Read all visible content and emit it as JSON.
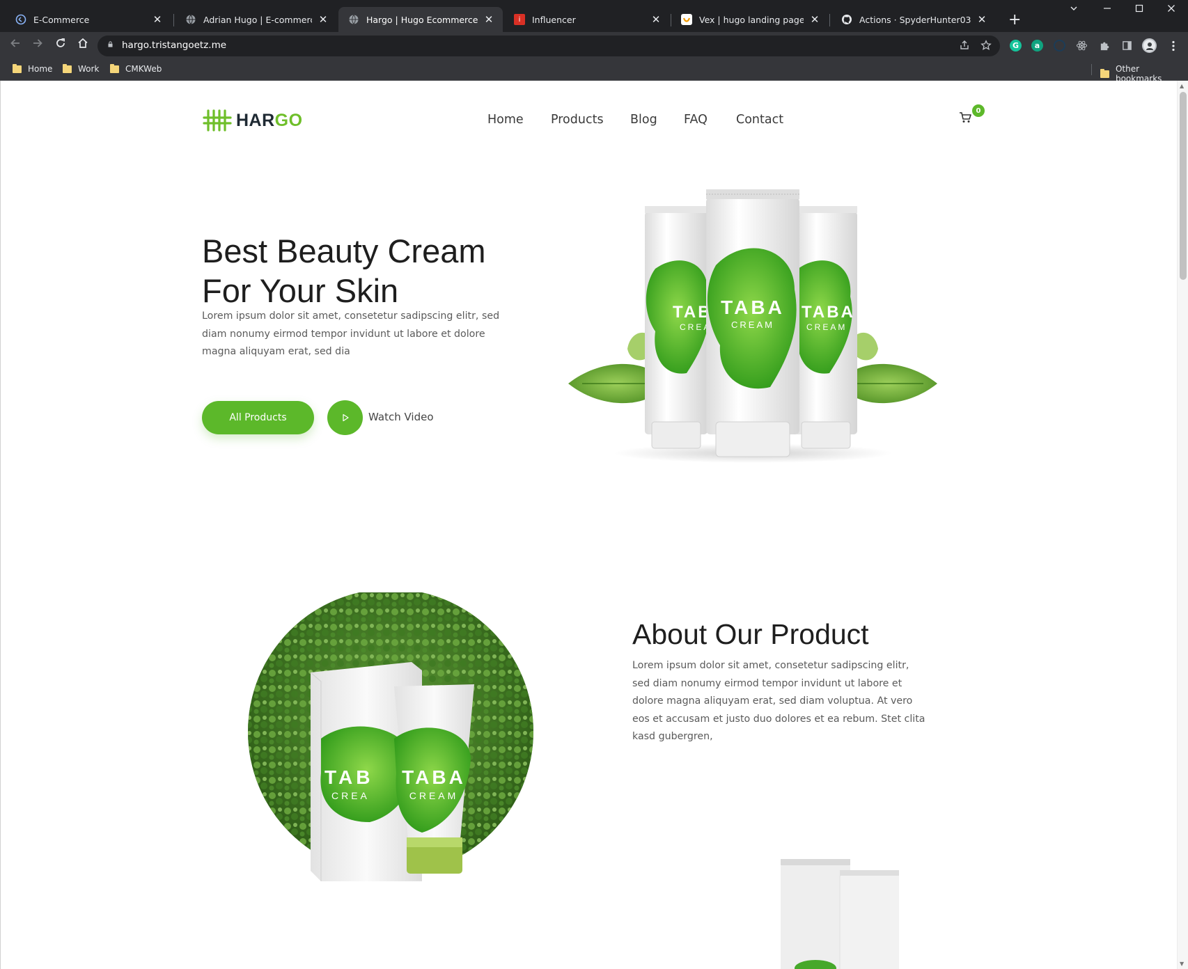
{
  "browser": {
    "tabs": [
      {
        "title": "E-Commerce",
        "icon": "ecommerce-favicon"
      },
      {
        "title": "Adrian Hugo | E-commerce temp",
        "icon": "globe-favicon"
      },
      {
        "title": "Hargo | Hugo Ecommerce Site",
        "icon": "globe-favicon",
        "active": true
      },
      {
        "title": "Influencer",
        "icon": "influencer-favicon"
      },
      {
        "title": "Vex | hugo landing page templat",
        "icon": "vex-favicon"
      },
      {
        "title": "Actions · SpyderHunter03/hugo-",
        "icon": "github-favicon"
      }
    ],
    "new_tab_glyph": "+",
    "url": "hargo.tristangoetz.me",
    "bookmarks": [
      {
        "label": "Home"
      },
      {
        "label": "Work"
      },
      {
        "label": "CMKWeb"
      }
    ],
    "other_bookmarks": "Other bookmarks",
    "colors": {
      "frame": "#202124",
      "toolbar": "#35363a",
      "text": "#e8eaed"
    }
  },
  "site": {
    "logo": {
      "text_main": "HAR",
      "text_accent": "GO"
    },
    "nav": [
      {
        "label": "Home"
      },
      {
        "label": "Products"
      },
      {
        "label": "Blog"
      },
      {
        "label": "FAQ"
      },
      {
        "label": "Contact"
      }
    ],
    "cart": {
      "count": "0",
      "icon": "cart-icon"
    },
    "hero": {
      "title_line1": "Best Beauty Cream",
      "title_line2": "For Your Skin",
      "text": "Lorem ipsum dolor sit amet, consetetur sadipscing elitr, sed diam nonumy eirmod tempor invidunt ut labore et dolore magna aliquyam erat, sed dia",
      "primary_button": "All Products",
      "video_button": "Watch Video",
      "product_brand": "TABA",
      "product_sub": "CREAM"
    },
    "about": {
      "title": "About Our Product",
      "text": "Lorem ipsum dolor sit amet, consetetur sadipscing elitr, sed diam nonumy eirmod tempor invidunt ut labore et dolore magna aliquyam erat, sed diam voluptua. At vero eos et accusam et justo duo dolores et ea rebum. Stet clita kasd gubergren,",
      "box_brand": "TAB",
      "box_sub": "CREA",
      "tube_brand": "TABA",
      "tube_sub": "CREAM"
    },
    "colors": {
      "accent": "#5cb82a",
      "heading": "#1e1e1e",
      "body": "#5a5a5a"
    }
  }
}
